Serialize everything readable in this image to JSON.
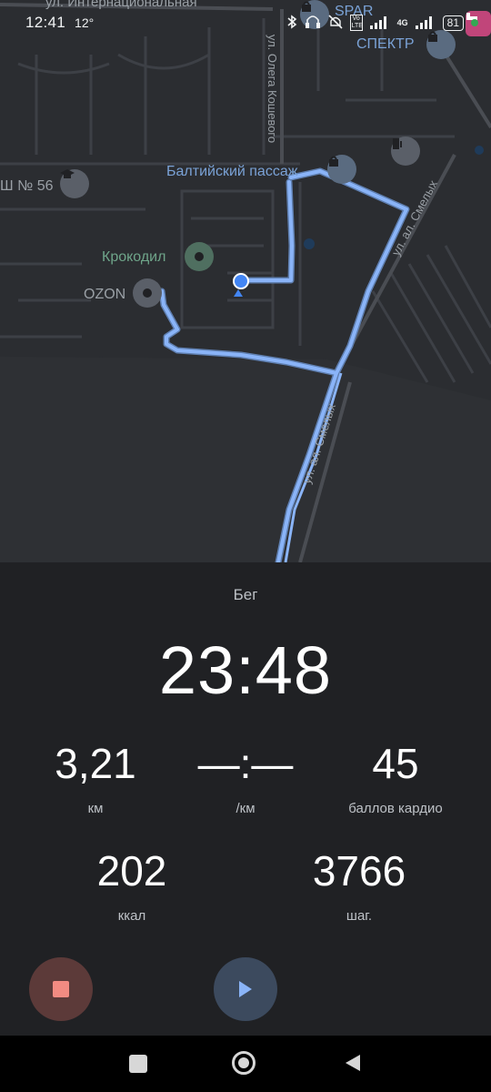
{
  "status_bar": {
    "time": "12:41",
    "temperature": "12°",
    "network": "4G",
    "volte": "Vo LTE",
    "battery": "81"
  },
  "map": {
    "street_labels": {
      "internatsionalnaya": "ул. Интернациональная",
      "olega_koshevogo": "ул. Олега Кошевого",
      "al_smelyh_upper": "ул. ал. Смелых",
      "al_smelyh_lower": "ул. ал. Смелых"
    },
    "places": {
      "spar": "SPAR",
      "spektr": "СПЕКТР",
      "baltiyskiy": "Балтийский пассаж",
      "school": "Ш № 56",
      "krokodil": "Крокодил",
      "ozon": "OZON"
    },
    "route_color": "#8ab4f8",
    "position_color": "#4285f4"
  },
  "workout": {
    "activity": "Бег",
    "elapsed": "23:48",
    "distance_value": "3,21",
    "distance_unit": "км",
    "pace_value": "—:—",
    "pace_unit": "/км",
    "cardio_value": "45",
    "cardio_unit": "баллов кардио",
    "calories_value": "202",
    "calories_unit": "ккал",
    "steps_value": "3766",
    "steps_unit": "шаг."
  },
  "controls": {
    "stop_icon": "stop-icon",
    "play_icon": "play-icon"
  },
  "nav": {
    "recents_icon": "square-icon",
    "home_icon": "circle-icon",
    "back_icon": "triangle-back-icon"
  }
}
